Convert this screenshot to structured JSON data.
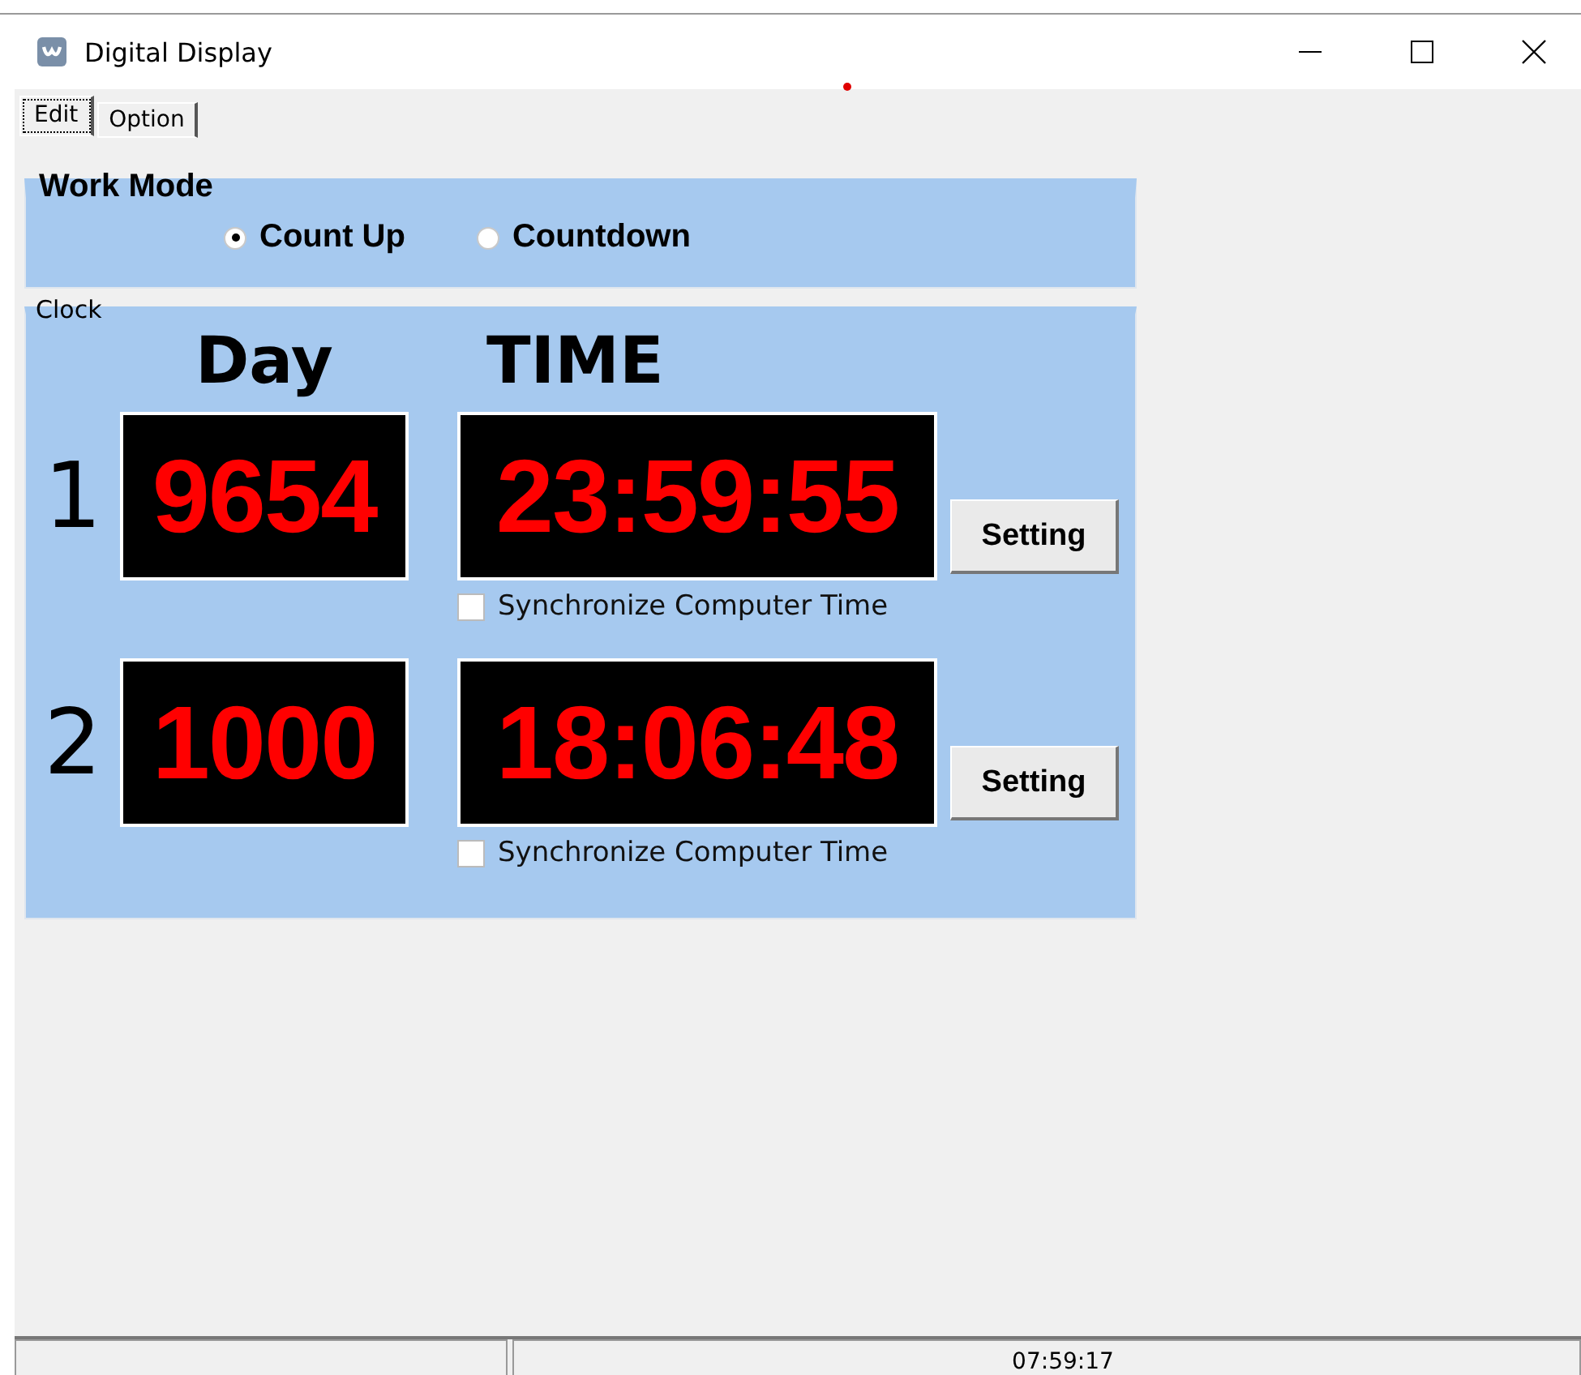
{
  "window": {
    "title": "Digital Display"
  },
  "tabs": [
    {
      "label": "Edit",
      "selected": true
    },
    {
      "label": "Option",
      "selected": false
    }
  ],
  "work_mode": {
    "title": "Work Mode",
    "options": [
      {
        "label": "Count Up",
        "selected": true
      },
      {
        "label": "Countdown",
        "selected": false
      }
    ]
  },
  "clock": {
    "title": "Clock",
    "headers": [
      "Day",
      "TIME"
    ],
    "rows": [
      {
        "index": "1",
        "day": "9654",
        "time": "23:59:55",
        "button": "Setting",
        "sync": {
          "label": "Synchronize Computer Time",
          "checked": false
        }
      },
      {
        "index": "2",
        "day": "1000",
        "time": "18:06:48",
        "button": "Setting",
        "sync": {
          "label": "Synchronize Computer Time",
          "checked": false
        }
      }
    ]
  },
  "status_bar": {
    "time": "07:59:17"
  }
}
